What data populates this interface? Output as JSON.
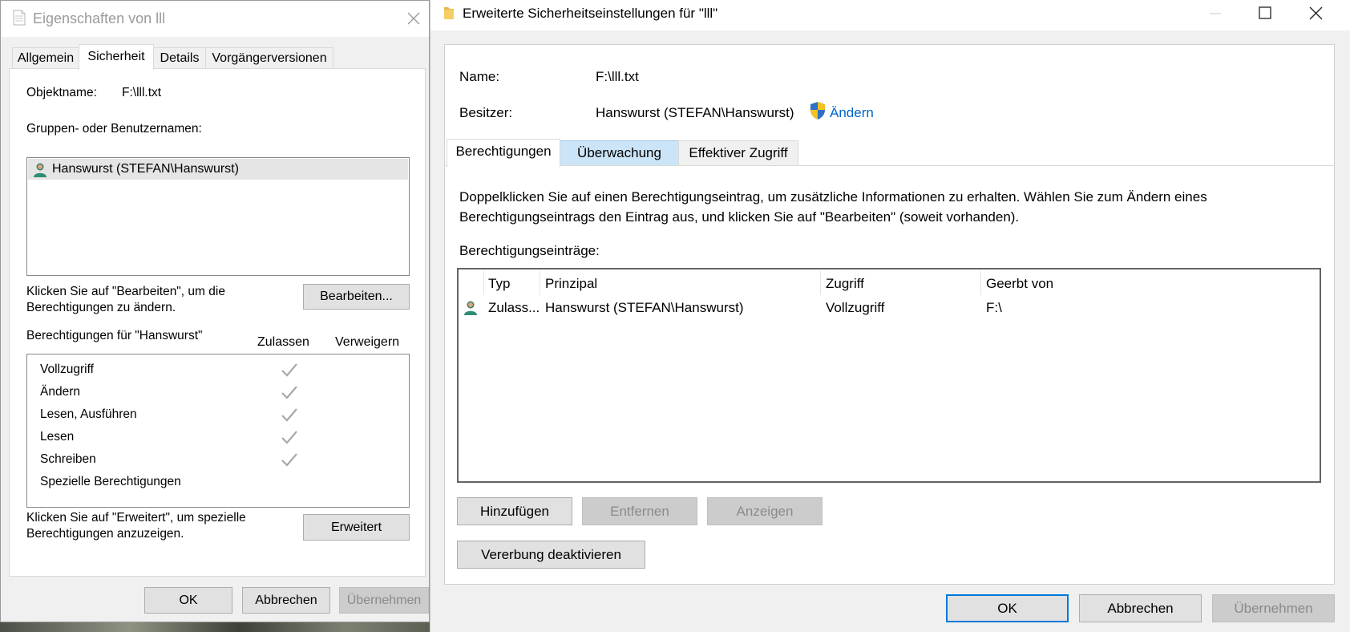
{
  "left_dialog": {
    "title": "Eigenschaften von lll",
    "tabs": [
      "Allgemein",
      "Sicherheit",
      "Details",
      "Vorgängerversionen"
    ],
    "object_name_label": "Objektname:",
    "object_name_value": "F:\\lll.txt",
    "groups_label": "Gruppen- oder Benutzernamen:",
    "users": [
      "Hanswurst (STEFAN\\Hanswurst)"
    ],
    "edit_hint_line1": "Klicken Sie auf \"Bearbeiten\", um die",
    "edit_hint_line2": "Berechtigungen zu ändern.",
    "edit_button": "Bearbeiten...",
    "permissions_for_label": "Berechtigungen für \"Hanswurst\"",
    "allow_header": "Zulassen",
    "deny_header": "Verweigern",
    "permissions": [
      {
        "name": "Vollzugriff",
        "allow": true
      },
      {
        "name": "Ändern",
        "allow": true
      },
      {
        "name": "Lesen, Ausführen",
        "allow": true
      },
      {
        "name": "Lesen",
        "allow": true
      },
      {
        "name": "Schreiben",
        "allow": true
      },
      {
        "name": "Spezielle Berechtigungen",
        "allow": false
      }
    ],
    "advanced_hint_line1": "Klicken Sie auf \"Erweitert\", um spezielle",
    "advanced_hint_line2": "Berechtigungen anzuzeigen.",
    "advanced_button": "Erweitert",
    "ok": "OK",
    "cancel": "Abbrechen",
    "apply": "Übernehmen"
  },
  "right_dialog": {
    "title": "Erweiterte Sicherheitseinstellungen für \"lll\"",
    "name_label": "Name:",
    "name_value": "F:\\lll.txt",
    "owner_label": "Besitzer:",
    "owner_value": "Hanswurst (STEFAN\\Hanswurst)",
    "change_link": "Ändern",
    "tabs": [
      "Berechtigungen",
      "Überwachung",
      "Effektiver Zugriff"
    ],
    "description_line1": "Doppelklicken Sie auf einen Berechtigungseintrag, um zusätzliche Informationen zu erhalten. Wählen Sie zum Ändern eines",
    "description_line2": "Berechtigungseintrags den Eintrag aus, und klicken Sie auf \"Bearbeiten\" (soweit vorhanden).",
    "entries_label": "Berechtigungseinträge:",
    "columns": [
      "Typ",
      "Prinzipal",
      "Zugriff",
      "Geerbt von"
    ],
    "rows": [
      {
        "type": "Zulass...",
        "principal": "Hanswurst (STEFAN\\Hanswurst)",
        "access": "Vollzugriff",
        "inherited_from": "F:\\"
      }
    ],
    "add_button": "Hinzufügen",
    "remove_button": "Entfernen",
    "view_button": "Anzeigen",
    "disable_inheritance_button": "Vererbung deaktivieren",
    "ok": "OK",
    "cancel": "Abbrechen",
    "apply": "Übernehmen"
  },
  "colors": {
    "accent": "#0078d7",
    "link": "#0066cc",
    "tab_highlight": "#cce4f7",
    "selected_row": "#e5e5e5"
  }
}
